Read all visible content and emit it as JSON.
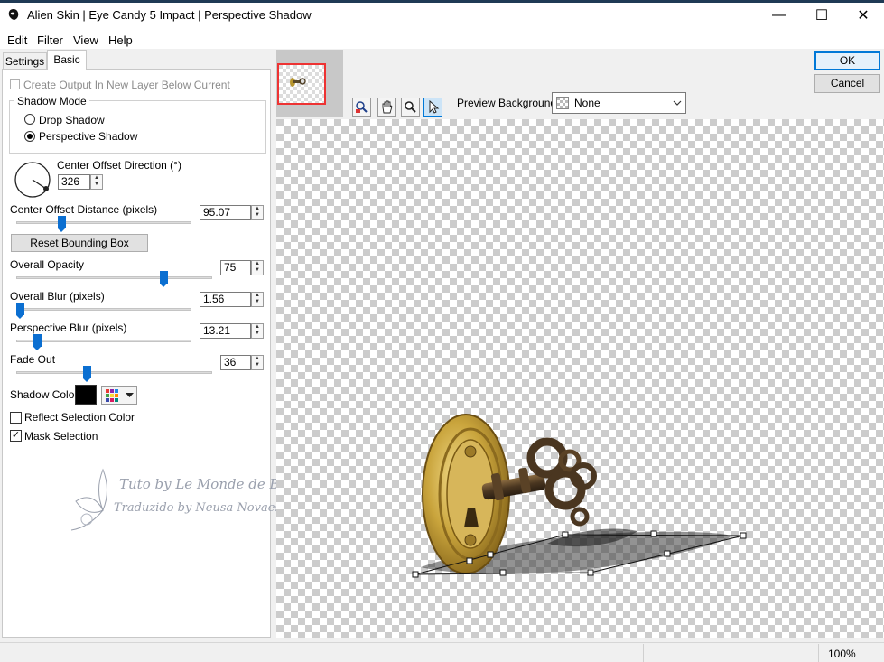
{
  "window": {
    "title": "Alien Skin | Eye Candy 5 Impact | Perspective Shadow",
    "minimize_label": "—",
    "maximize_label": "☐",
    "close_label": "✕"
  },
  "menu": [
    "Edit",
    "Filter",
    "View",
    "Help"
  ],
  "tabs": {
    "settings": "Settings",
    "basic": "Basic"
  },
  "panel": {
    "create_output_label": "Create Output In New Layer Below Current",
    "shadow_mode_label": "Shadow Mode",
    "drop_shadow_label": "Drop Shadow",
    "perspective_shadow_label": "Perspective Shadow",
    "selected_mode": "Perspective Shadow",
    "center_offset_direction_label": "Center Offset Direction (°)",
    "center_offset_direction_value": "326",
    "center_offset_distance_label": "Center Offset Distance (pixels)",
    "center_offset_distance_value": "95.07",
    "reset_bounding_box_label": "Reset Bounding Box",
    "overall_opacity_label": "Overall Opacity",
    "overall_opacity_value": "75",
    "overall_blur_label": "Overall Blur (pixels)",
    "overall_blur_value": "1.56",
    "perspective_blur_label": "Perspective Blur (pixels)",
    "perspective_blur_value": "13.21",
    "fade_out_label": "Fade Out",
    "fade_out_value": "36",
    "shadow_color_label": "Shadow Color",
    "shadow_color": "#000000",
    "reflect_selection_label": "Reflect Selection Color",
    "reflect_selection_checked": false,
    "mask_selection_label": "Mask Selection",
    "mask_selection_checked": true,
    "slider_levels": {
      "center_offset_distance": 0.26,
      "overall_opacity": 0.75,
      "overall_blur": 0.02,
      "perspective_blur": 0.12,
      "fade_out": 0.36
    }
  },
  "watermark": {
    "line1": "Tuto by Le Monde de Bea",
    "line2": "Traduzido by Neusa Novaes"
  },
  "toolbar": {
    "icons": [
      "zoom-fit-icon",
      "hand-tool-icon",
      "zoom-tool-icon",
      "pointer-tool-icon"
    ],
    "preview_background_label": "Preview Background:",
    "preview_background_value": "None"
  },
  "buttons": {
    "ok": "OK",
    "cancel": "Cancel"
  },
  "status": {
    "zoom": "100%"
  },
  "colors": {
    "accent": "#0078d7",
    "slider_thumb": "#0b6fd1",
    "navigator_border": "#ee3333"
  }
}
